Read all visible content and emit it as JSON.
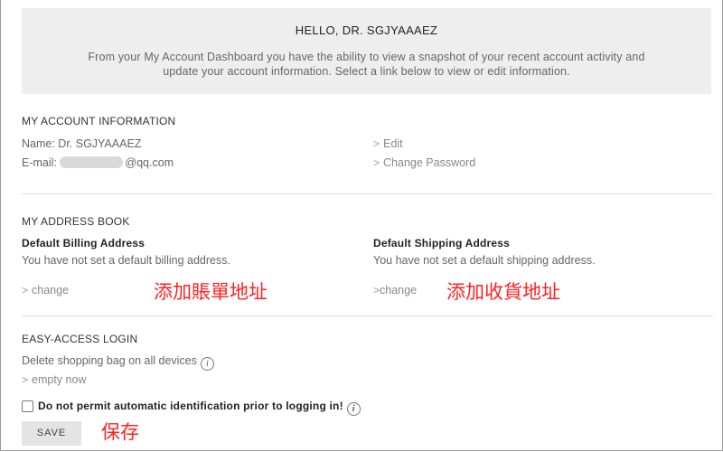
{
  "header": {
    "greeting": "HELLO, DR.  SGJYAAAEZ",
    "description_line1": "From your My Account Dashboard you have the ability to view a snapshot of your recent account activity and",
    "description_line2": "update your account information. Select a link below to view or edit information."
  },
  "account_info": {
    "title": "MY ACCOUNT INFORMATION",
    "name": "Name: Dr. SGJYAAAEZ",
    "email_label": "E-mail:",
    "email_suffix": "@qq.com",
    "edit_link": "Edit",
    "change_password_link": "Change Password"
  },
  "address_book": {
    "title": "MY ADDRESS BOOK",
    "billing_title": "Default Billing Address",
    "billing_text": "You have not set a default billing address.",
    "billing_change": "change",
    "billing_note": "添加賬單地址",
    "shipping_title": "Default Shipping Address",
    "shipping_text": "You have not set a default shipping address.",
    "shipping_change": "change",
    "shipping_note": "添加收貨地址"
  },
  "easy_access": {
    "title": "EASY-ACCESS LOGIN",
    "delete_bag_text": "Delete shopping bag on all devices",
    "empty_now_link": "empty now",
    "checkbox_label": "Do not permit automatic identification prior to logging in!",
    "checkbox_checked": false,
    "save_label": "SAVE",
    "save_note": "保存"
  },
  "icons": {
    "chevron": "chevron-right-icon",
    "info": "info-icon"
  },
  "colors": {
    "annotation": "#ff2020",
    "header_bg": "#eeeeee"
  }
}
